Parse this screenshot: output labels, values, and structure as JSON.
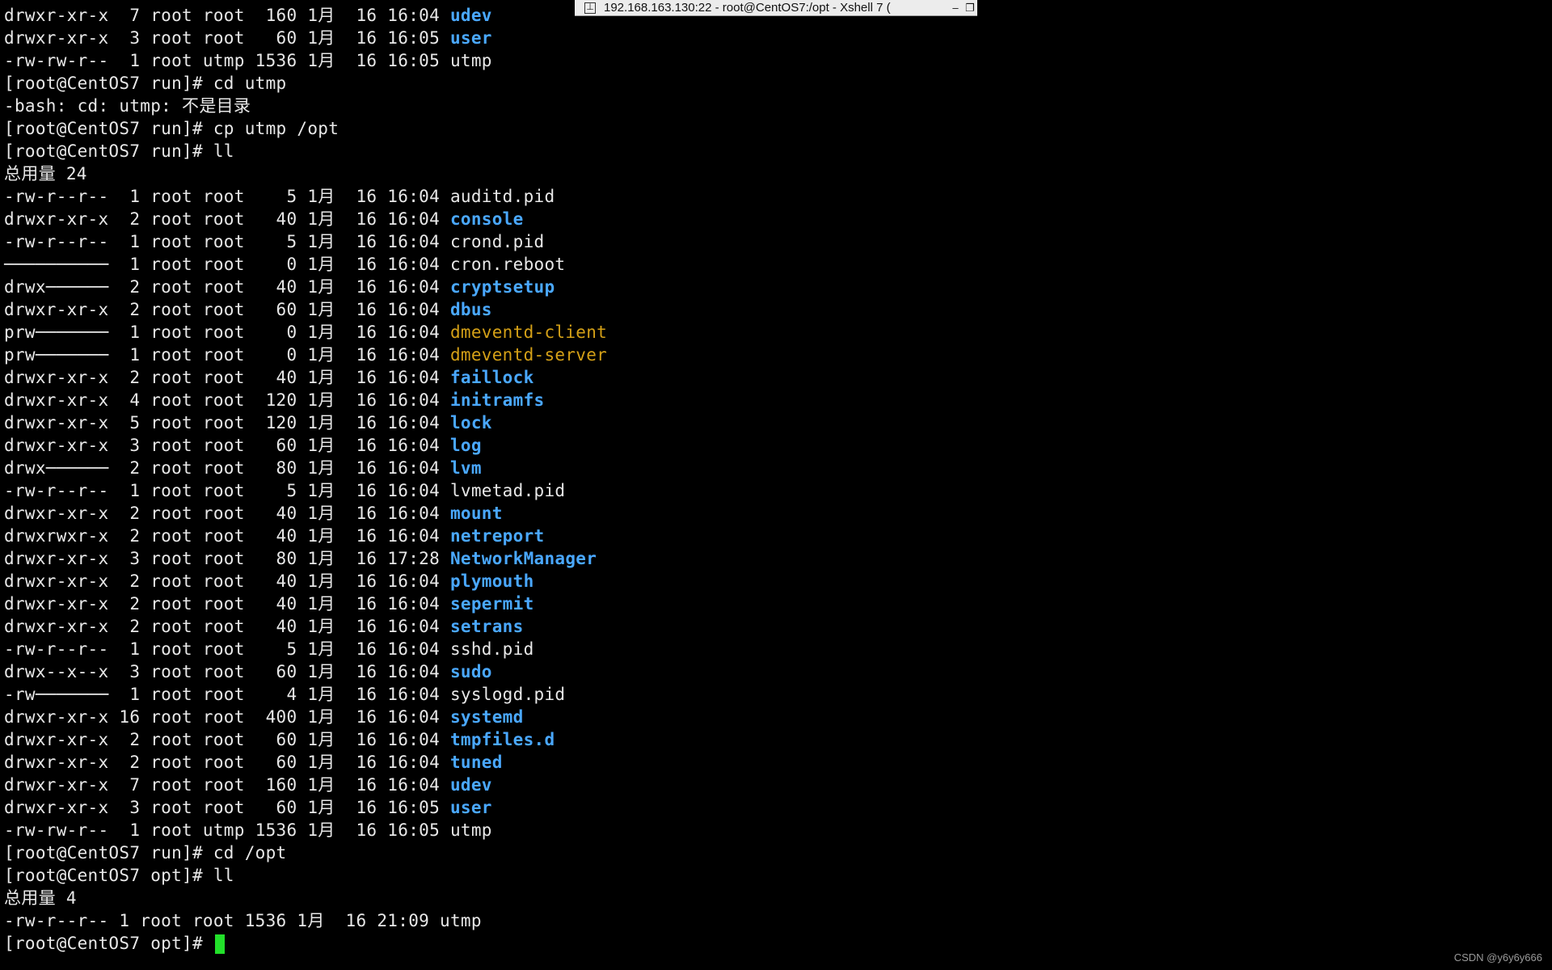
{
  "window": {
    "title": "192.168.163.130:22 - root@CentOS7:/opt - Xshell 7 (",
    "pin_glyph": "⊥",
    "minimize_glyph": "–",
    "restore_glyph": "❐"
  },
  "watermark": "CSDN @y6y6y666",
  "colors": {
    "background": "#000000",
    "text": "#e8e8e8",
    "directory": "#4aa8ff",
    "fifo": "#d4a017",
    "cursor": "#22e02a"
  },
  "terminal": {
    "lines": [
      [
        {
          "t": "drwxr-xr-x  7 root root  160 1月  16 16:04 "
        },
        {
          "t": "udev",
          "c": "dir"
        }
      ],
      [
        {
          "t": "drwxr-xr-x  3 root root   60 1月  16 16:05 "
        },
        {
          "t": "user",
          "c": "dir"
        }
      ],
      [
        {
          "t": "-rw-rw-r--  1 root utmp 1536 1月  16 16:05 utmp"
        }
      ],
      [
        {
          "t": "[root@CentOS7 run]# cd utmp"
        }
      ],
      [
        {
          "t": "-bash: cd: utmp: 不是目录"
        }
      ],
      [
        {
          "t": "[root@CentOS7 run]# cp utmp /opt"
        }
      ],
      [
        {
          "t": "[root@CentOS7 run]# ll"
        }
      ],
      [
        {
          "t": "总用量 24"
        }
      ],
      [
        {
          "t": "-rw-r--r--  1 root root    5 1月  16 16:04 auditd.pid"
        }
      ],
      [
        {
          "t": "drwxr-xr-x  2 root root   40 1月  16 16:04 "
        },
        {
          "t": "console",
          "c": "dir"
        }
      ],
      [
        {
          "t": "-rw-r--r--  1 root root    5 1月  16 16:04 crond.pid"
        }
      ],
      [
        {
          "t": "──────────  1 root root    0 1月  16 16:04 cron.reboot"
        }
      ],
      [
        {
          "t": "drwx──────  2 root root   40 1月  16 16:04 "
        },
        {
          "t": "cryptsetup",
          "c": "dir"
        }
      ],
      [
        {
          "t": "drwxr-xr-x  2 root root   60 1月  16 16:04 "
        },
        {
          "t": "dbus",
          "c": "dir"
        }
      ],
      [
        {
          "t": "prw───────  1 root root    0 1月  16 16:04 "
        },
        {
          "t": "dmeventd-client",
          "c": "fifo"
        }
      ],
      [
        {
          "t": "prw───────  1 root root    0 1月  16 16:04 "
        },
        {
          "t": "dmeventd-server",
          "c": "fifo"
        }
      ],
      [
        {
          "t": "drwxr-xr-x  2 root root   40 1月  16 16:04 "
        },
        {
          "t": "faillock",
          "c": "dir"
        }
      ],
      [
        {
          "t": "drwxr-xr-x  4 root root  120 1月  16 16:04 "
        },
        {
          "t": "initramfs",
          "c": "dir"
        }
      ],
      [
        {
          "t": "drwxr-xr-x  5 root root  120 1月  16 16:04 "
        },
        {
          "t": "lock",
          "c": "dir"
        }
      ],
      [
        {
          "t": "drwxr-xr-x  3 root root   60 1月  16 16:04 "
        },
        {
          "t": "log",
          "c": "dir"
        }
      ],
      [
        {
          "t": "drwx──────  2 root root   80 1月  16 16:04 "
        },
        {
          "t": "lvm",
          "c": "dir"
        }
      ],
      [
        {
          "t": "-rw-r--r--  1 root root    5 1月  16 16:04 lvmetad.pid"
        }
      ],
      [
        {
          "t": "drwxr-xr-x  2 root root   40 1月  16 16:04 "
        },
        {
          "t": "mount",
          "c": "dir"
        }
      ],
      [
        {
          "t": "drwxrwxr-x  2 root root   40 1月  16 16:04 "
        },
        {
          "t": "netreport",
          "c": "dir"
        }
      ],
      [
        {
          "t": "drwxr-xr-x  3 root root   80 1月  16 17:28 "
        },
        {
          "t": "NetworkManager",
          "c": "dir"
        }
      ],
      [
        {
          "t": "drwxr-xr-x  2 root root   40 1月  16 16:04 "
        },
        {
          "t": "plymouth",
          "c": "dir"
        }
      ],
      [
        {
          "t": "drwxr-xr-x  2 root root   40 1月  16 16:04 "
        },
        {
          "t": "sepermit",
          "c": "dir"
        }
      ],
      [
        {
          "t": "drwxr-xr-x  2 root root   40 1月  16 16:04 "
        },
        {
          "t": "setrans",
          "c": "dir"
        }
      ],
      [
        {
          "t": "-rw-r--r--  1 root root    5 1月  16 16:04 sshd.pid"
        }
      ],
      [
        {
          "t": "drwx--x--x  3 root root   60 1月  16 16:04 "
        },
        {
          "t": "sudo",
          "c": "dir"
        }
      ],
      [
        {
          "t": "-rw───────  1 root root    4 1月  16 16:04 syslogd.pid"
        }
      ],
      [
        {
          "t": "drwxr-xr-x 16 root root  400 1月  16 16:04 "
        },
        {
          "t": "systemd",
          "c": "dir"
        }
      ],
      [
        {
          "t": "drwxr-xr-x  2 root root   60 1月  16 16:04 "
        },
        {
          "t": "tmpfiles.d",
          "c": "dir"
        }
      ],
      [
        {
          "t": "drwxr-xr-x  2 root root   60 1月  16 16:04 "
        },
        {
          "t": "tuned",
          "c": "dir"
        }
      ],
      [
        {
          "t": "drwxr-xr-x  7 root root  160 1月  16 16:04 "
        },
        {
          "t": "udev",
          "c": "dir"
        }
      ],
      [
        {
          "t": "drwxr-xr-x  3 root root   60 1月  16 16:05 "
        },
        {
          "t": "user",
          "c": "dir"
        }
      ],
      [
        {
          "t": "-rw-rw-r--  1 root utmp 1536 1月  16 16:05 utmp"
        }
      ],
      [
        {
          "t": "[root@CentOS7 run]# cd /opt"
        }
      ],
      [
        {
          "t": "[root@CentOS7 opt]# ll"
        }
      ],
      [
        {
          "t": "总用量 4"
        }
      ],
      [
        {
          "t": "-rw-r--r-- 1 root root 1536 1月  16 21:09 utmp"
        }
      ],
      [
        {
          "t": "[root@CentOS7 opt]# "
        }
      ]
    ]
  }
}
